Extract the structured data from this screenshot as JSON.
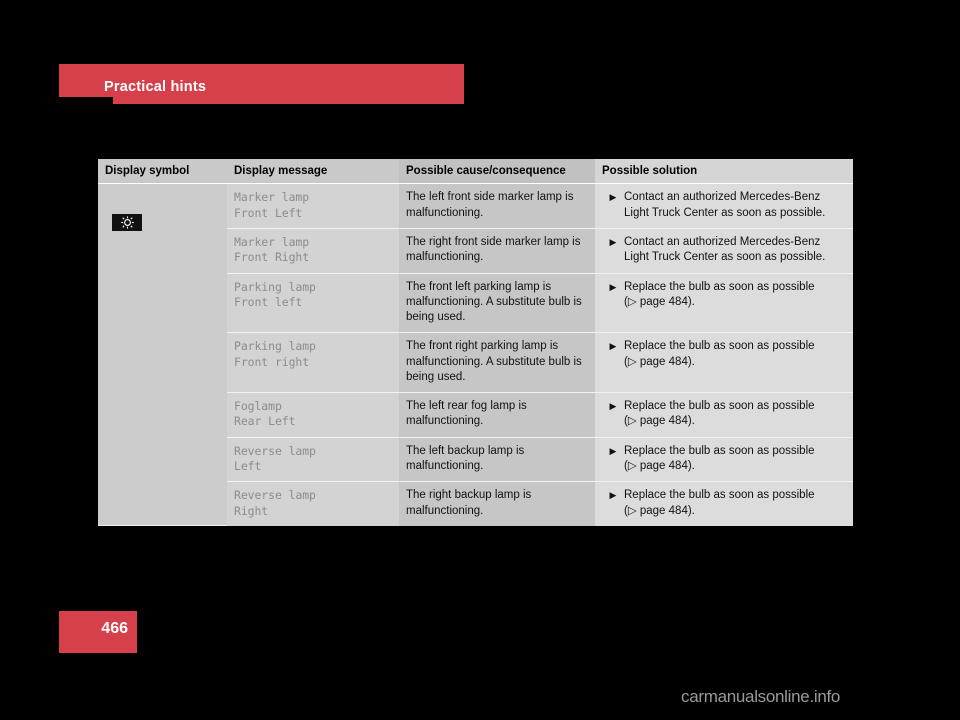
{
  "header": {
    "title": "Practical hints"
  },
  "table": {
    "columns": [
      "Display symbol",
      "Display message",
      "Possible cause/consequence",
      "Possible solution"
    ],
    "symbol_icon": "lamp-indicator-icon",
    "bullet_glyph": "▶",
    "page_ref_glyph": "▷",
    "rows": [
      {
        "message": "Marker lamp\nFront Left",
        "cause": "The left front side marker lamp is malfunctioning.",
        "solution": "Contact an authorized Mercedes-Benz Light Truck Center as soon as possible."
      },
      {
        "message": "Marker lamp\nFront Right",
        "cause": "The right front side marker lamp is malfunctioning.",
        "solution": "Contact an authorized Mercedes-Benz Light Truck Center as soon as possible."
      },
      {
        "message": "Parking lamp\nFront left",
        "cause": "The front left parking lamp is malfunctioning. A substitute bulb is being used.",
        "solution": "Replace the bulb as soon as possible\n(▷ page 484)."
      },
      {
        "message": "Parking lamp\nFront right",
        "cause": "The front right parking lamp is malfunctioning. A substitute bulb is being used.",
        "solution": "Replace the bulb as soon as possible\n(▷ page 484)."
      },
      {
        "message": "Foglamp\nRear Left",
        "cause": "The left rear fog lamp is malfunctioning.",
        "solution": "Replace the bulb as soon as possible\n(▷ page 484)."
      },
      {
        "message": "Reverse lamp\nLeft",
        "cause": "The left backup lamp is malfunctioning.",
        "solution": "Replace the bulb as soon as possible\n(▷ page 484)."
      },
      {
        "message": "Reverse lamp\nRight",
        "cause": "The right backup lamp is malfunctioning.",
        "solution": "Replace the bulb as soon as possible\n(▷ page 484)."
      }
    ]
  },
  "footer": {
    "page_number": "466",
    "watermark": "carmanualsonline.info"
  },
  "colors": {
    "accent_red": "#d6404a",
    "page_background": "#000000",
    "table_header": "#c9c9c9",
    "symbol_column": "#cccccc",
    "message_column": "#d3d3d3",
    "cause_column": "#c6c6c6",
    "solution_column": "#dcdcdc",
    "message_text": "#8c8c8c"
  }
}
